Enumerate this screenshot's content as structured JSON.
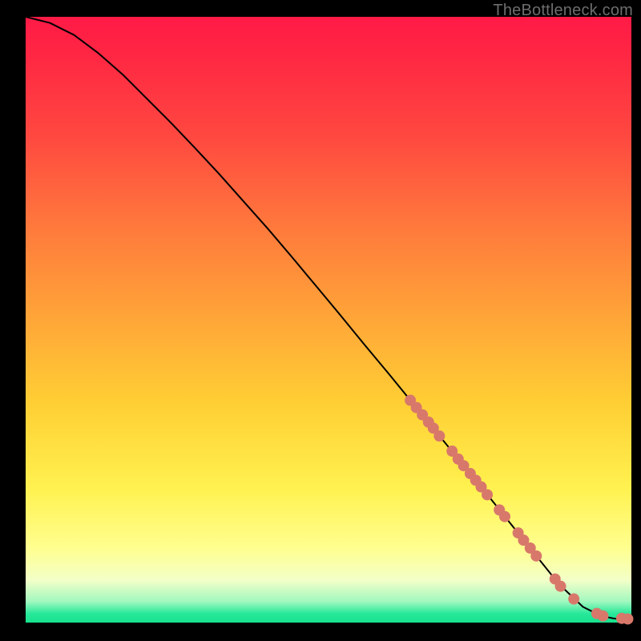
{
  "watermark": "TheBottleneck.com",
  "chart_data": {
    "type": "line",
    "title": "",
    "xlabel": "",
    "ylabel": "",
    "xlim": [
      0,
      100
    ],
    "ylim": [
      0,
      100
    ],
    "curve": {
      "name": "bottleneck-curve",
      "x": [
        0,
        4,
        8,
        12,
        16,
        20,
        24,
        28,
        32,
        36,
        40,
        44,
        48,
        52,
        56,
        60,
        64,
        68,
        72,
        76,
        80,
        84,
        88,
        92,
        95,
        97,
        98,
        100
      ],
      "y": [
        100,
        99,
        97,
        94,
        90.5,
        86.5,
        82.5,
        78.3,
        74,
        69.5,
        65,
        60.3,
        55.5,
        50.7,
        45.8,
        41,
        36.1,
        31.2,
        26.3,
        21.4,
        16.4,
        11.4,
        6.4,
        2.6,
        1.1,
        0.7,
        0.6,
        0.5
      ]
    },
    "markers": {
      "name": "marker-series",
      "color": "#d8786b",
      "radius": 7,
      "points": [
        {
          "x": 63.5,
          "y": 36.7
        },
        {
          "x": 64.5,
          "y": 35.5
        },
        {
          "x": 65.5,
          "y": 34.3
        },
        {
          "x": 66.5,
          "y": 33.1
        },
        {
          "x": 67.3,
          "y": 32.1
        },
        {
          "x": 68.3,
          "y": 30.8
        },
        {
          "x": 70.4,
          "y": 28.3
        },
        {
          "x": 71.4,
          "y": 27.0
        },
        {
          "x": 72.3,
          "y": 25.9
        },
        {
          "x": 73.4,
          "y": 24.6
        },
        {
          "x": 74.3,
          "y": 23.5
        },
        {
          "x": 75.2,
          "y": 22.4
        },
        {
          "x": 76.2,
          "y": 21.1
        },
        {
          "x": 78.2,
          "y": 18.6
        },
        {
          "x": 79.1,
          "y": 17.5
        },
        {
          "x": 81.3,
          "y": 14.8
        },
        {
          "x": 82.2,
          "y": 13.6
        },
        {
          "x": 83.3,
          "y": 12.3
        },
        {
          "x": 84.3,
          "y": 11.0
        },
        {
          "x": 87.4,
          "y": 7.2
        },
        {
          "x": 88.3,
          "y": 6.0
        },
        {
          "x": 90.5,
          "y": 3.9
        },
        {
          "x": 94.3,
          "y": 1.5
        },
        {
          "x": 95.3,
          "y": 1.1
        },
        {
          "x": 98.4,
          "y": 0.7
        },
        {
          "x": 99.4,
          "y": 0.6
        }
      ]
    }
  }
}
